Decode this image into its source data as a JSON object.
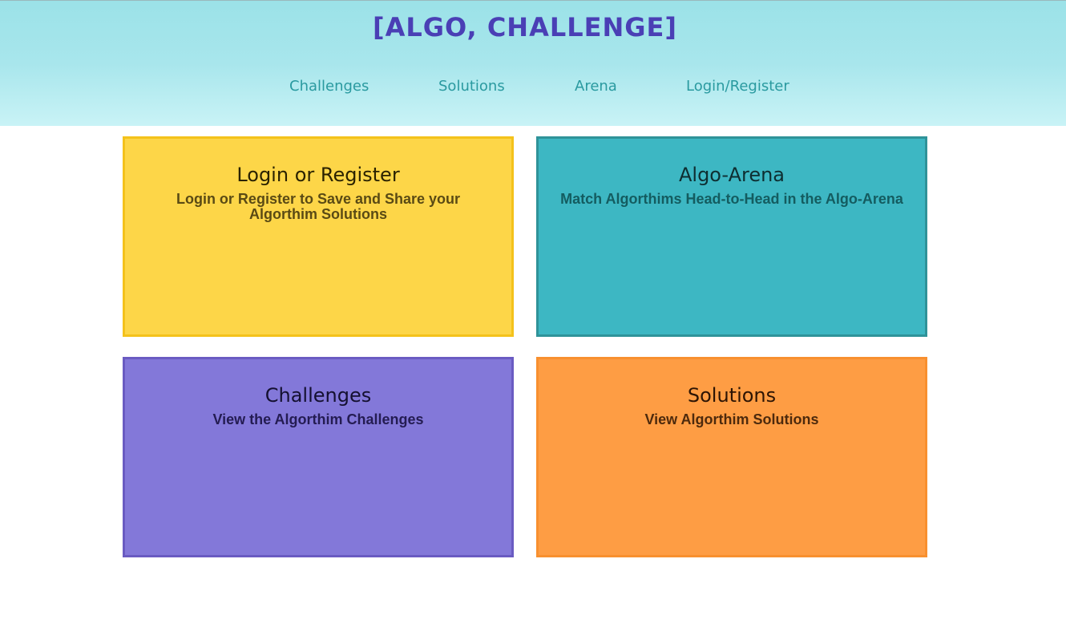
{
  "header": {
    "title": "[Algo, Challenge]",
    "nav": [
      {
        "label": "Challenges"
      },
      {
        "label": "Solutions"
      },
      {
        "label": "Arena"
      },
      {
        "label": "Login/Register"
      }
    ]
  },
  "cards": {
    "login": {
      "title": "Login or Register",
      "description": "Login or Register to Save and Share your Algorthim Solutions"
    },
    "arena": {
      "title": "Algo-Arena",
      "description": "Match Algorthims Head-to-Head in the Algo-Arena"
    },
    "challenges": {
      "title": "Challenges",
      "description": "View the Algorthim Challenges"
    },
    "solutions": {
      "title": "Solutions",
      "description": "View Algorthim Solutions"
    }
  },
  "colors": {
    "title": "#4a3fb5",
    "nav_link": "#2a9aa0",
    "login_card": "#fdd648",
    "arena_card": "#3db7c3",
    "challenges_card": "#8378d9",
    "solutions_card": "#fe9d44"
  }
}
